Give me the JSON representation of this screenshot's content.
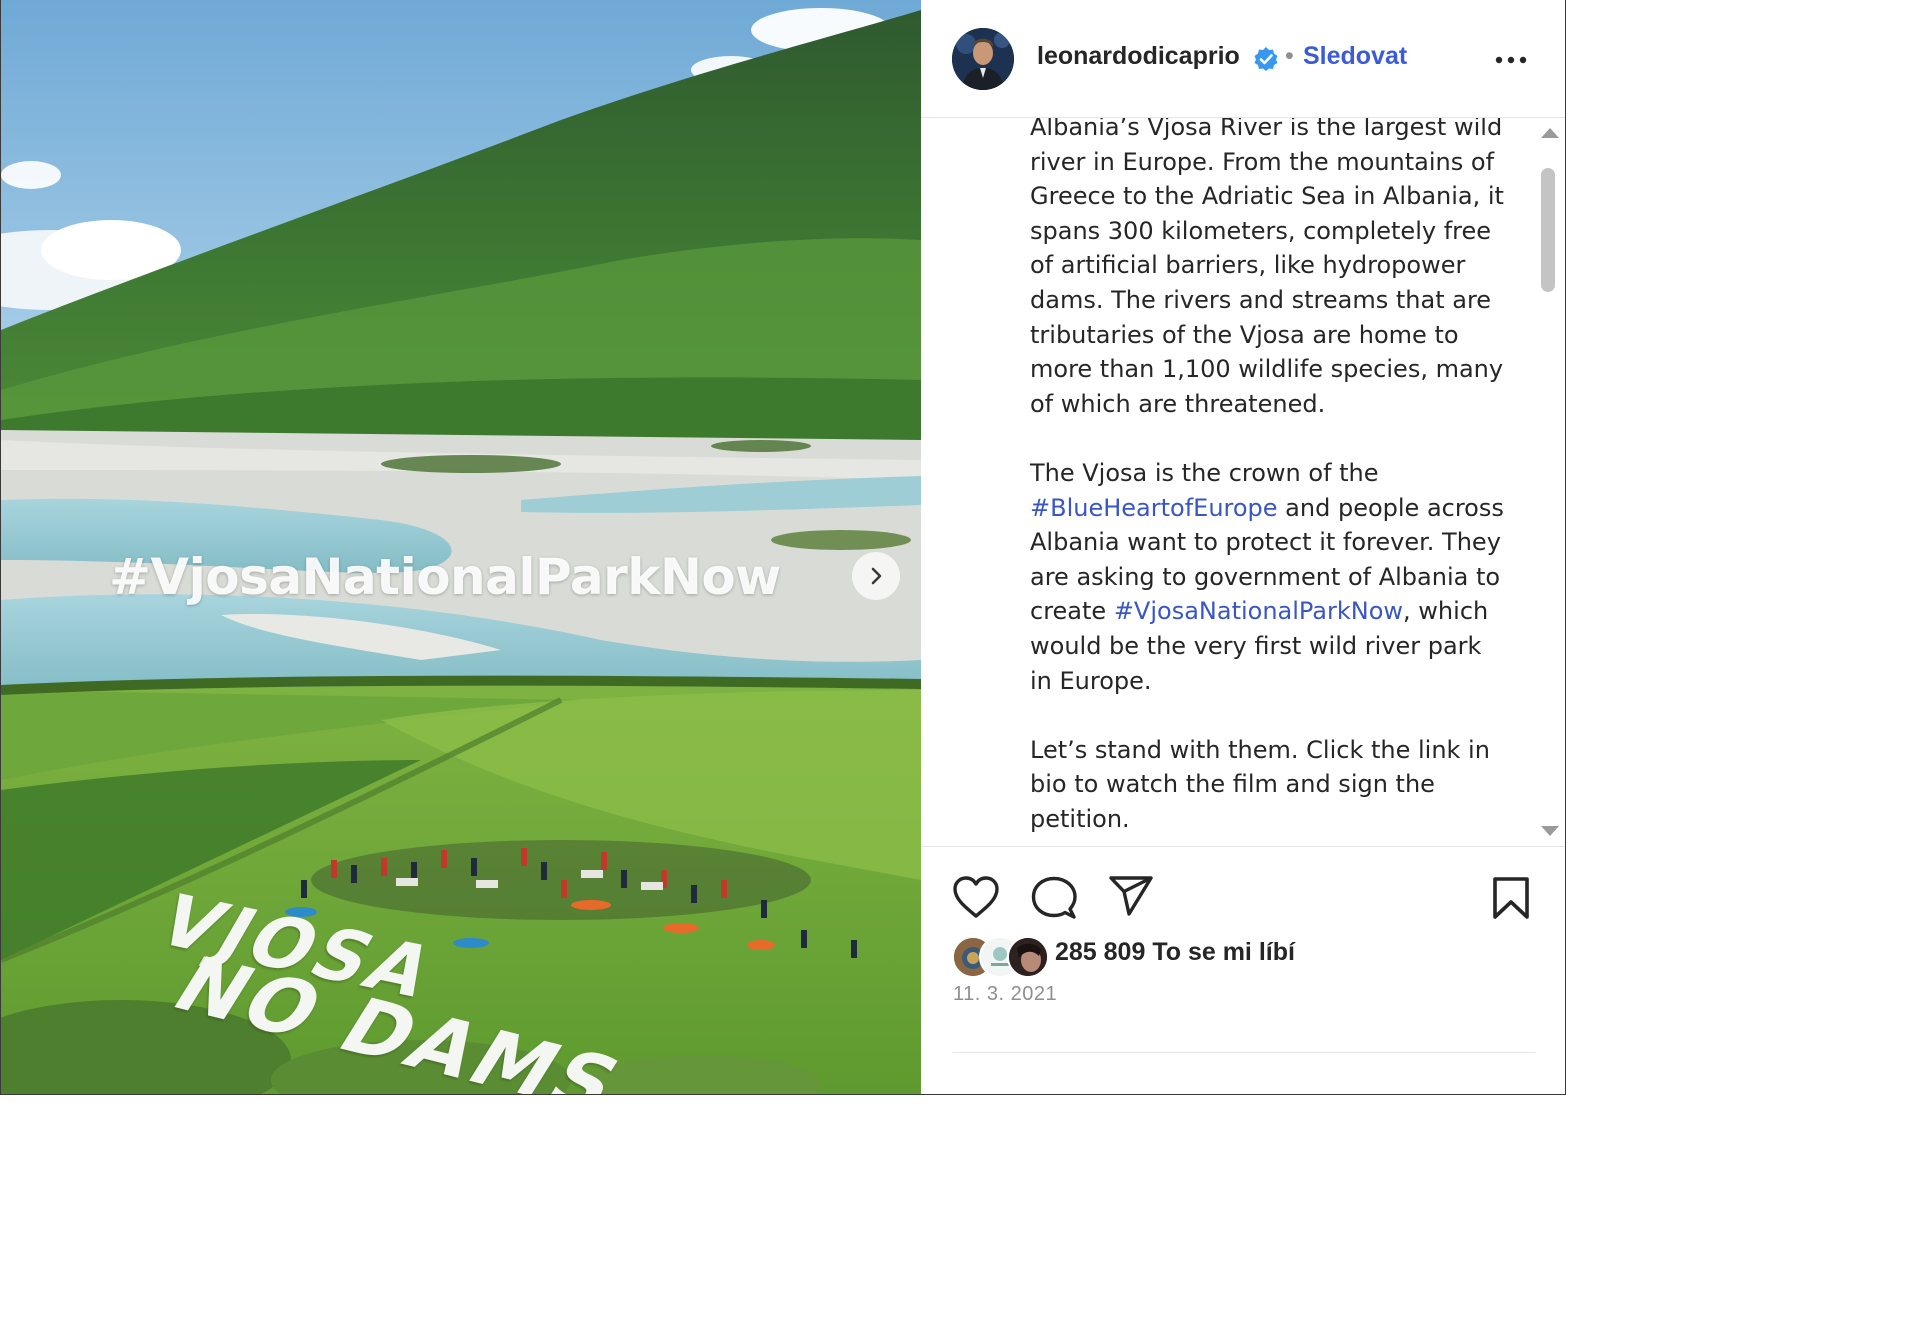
{
  "post": {
    "image_overlay": {
      "hashtag": "#VjosaNationalParkNow",
      "banner_line1": "VJOSA",
      "banner_line2": "NO DAMS"
    }
  },
  "header": {
    "username": "leonardodicaprio",
    "separator": "•",
    "follow_label": "Sledovat",
    "verified": true
  },
  "caption": {
    "paragraph1": "Albania’s Vjosa River is the largest wild river in Europe. From the mountains of Greece to the Adriatic Sea in Albania, it spans 300 kilometers, completely free of artificial barriers, like hydropower dams. The rivers and streams that are tributaries of the Vjosa are home to more than 1,100 wildlife species, many of which are threatened.",
    "paragraph2": {
      "part1": "The Vjosa is the crown of the ",
      "tag1": "#BlueHeartofEurope",
      "part2": " and people across Albania want to protect it forever. They are asking to government of Albania to create ",
      "tag2": "#VjosaNationalParkNow",
      "part3": ", which would be the very first wild river park in Europe."
    },
    "paragraph3": "Let’s stand with them. Click the link in bio to watch the film and sign the petition."
  },
  "engagement": {
    "likes_text": "285 809 To se mi líbí",
    "date": "11. 3. 2021"
  },
  "colors": {
    "link": "#3a56c4",
    "follow": "#3b5bdb",
    "verified": "#3897f0",
    "text": "#262626",
    "muted": "#8e8e8e"
  },
  "icons": [
    "like-icon",
    "comment-icon",
    "share-icon",
    "save-icon",
    "more-icon",
    "verified-icon",
    "chevron-right-icon"
  ]
}
